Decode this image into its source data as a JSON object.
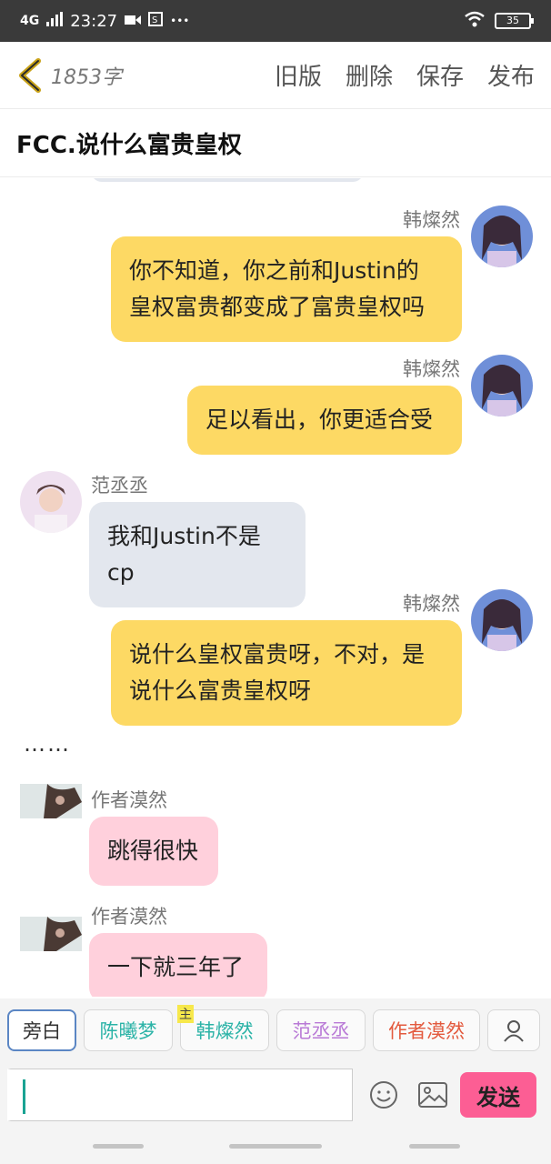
{
  "status_bar": {
    "network": "4G",
    "time": "23:27",
    "dots": "•••",
    "battery": "35"
  },
  "header": {
    "word_count": "1853字",
    "actions": [
      "旧版",
      "删除",
      "保存",
      "发布"
    ]
  },
  "doc_title": "FCC.说什么富贵皇权",
  "messages": [
    {
      "sender": "韩燦然",
      "text_lines": [
        "你不知道，你之前和Justin的",
        "皇权富贵都变成了富贵皇权吗"
      ]
    },
    {
      "sender": "韩燦然",
      "text_lines": [
        "足以看出，你更适合受"
      ]
    },
    {
      "sender": "范丞丞",
      "text_lines": [
        "我和Justin不是cp"
      ]
    },
    {
      "sender": "韩燦然",
      "text_lines": [
        "说什么皇权富贵呀，不对，是",
        "说什么富贵皇权呀"
      ]
    },
    {
      "narration": "……"
    },
    {
      "sender": "作者漠然",
      "text_lines": [
        "跳得很快"
      ]
    },
    {
      "sender": "作者漠然",
      "text_lines": [
        "一下就三年了"
      ]
    }
  ],
  "characters": [
    {
      "label": "旁白",
      "color": "#333333"
    },
    {
      "label": "陈曦梦",
      "color": "#2bb3a7"
    },
    {
      "label": "韩燦然",
      "color": "#2bb3a7",
      "badge": "主"
    },
    {
      "label": "范丞丞",
      "color": "#b97ad6"
    },
    {
      "label": "作者漠然",
      "color": "#e35a3e"
    }
  ],
  "input": {
    "value": ""
  },
  "send_label": "发送",
  "colors": {
    "yellow_bubble": "#fdd964",
    "grey_bubble": "#e3e7ee",
    "pink_bubble": "#ffd0dc",
    "send": "#fc5e94"
  },
  "icons": [
    "back-chevron-icon",
    "emoji-icon",
    "image-icon",
    "person-icon"
  ]
}
